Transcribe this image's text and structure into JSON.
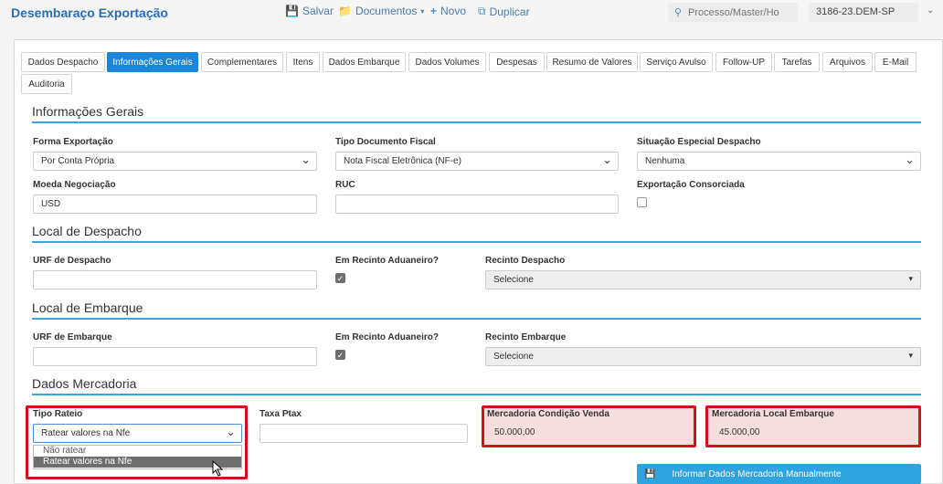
{
  "topbar": {
    "title": "Desembaraço Exportação",
    "save": "Salvar",
    "documents": "Documentos",
    "new": "Novo",
    "duplicate": "Duplicar",
    "search_placeholder": "Processo/Master/Ho",
    "process": "3186-23.DEM-SP"
  },
  "tabs": [
    "Dados Despacho",
    "Informações Gerais",
    "Complementares",
    "Itens",
    "Dados Embarque",
    "Dados Volumes",
    "Despesas",
    "Resumo de Valores",
    "Serviço Avulso",
    "Follow-UP",
    "Tarefas",
    "Arquivos",
    "E-Mail",
    "Auditoria"
  ],
  "active_tab": "Informações Gerais",
  "info_gerais": {
    "title": "Informações Gerais",
    "forma_label": "Forma Exportação",
    "forma_value": "Por Conta Própria",
    "tipo_doc_label": "Tipo Documento Fiscal",
    "tipo_doc_value": "Nota Fiscal Eletrônica (NF-e)",
    "situacao_label": "Situação Especial Despacho",
    "situacao_value": "Nenhuma",
    "moeda_label": "Moeda Negociação",
    "moeda_value": "USD",
    "ruc_label": "RUC",
    "ruc_value": "",
    "consorciada_label": "Exportação Consorciada"
  },
  "despacho": {
    "title": "Local de Despacho",
    "urf_label": "URF de Despacho",
    "urf_value": "",
    "recinto_q_label": "Em Recinto Aduaneiro?",
    "recinto_label": "Recinto Despacho",
    "recinto_value": "Selecione"
  },
  "embarque": {
    "title": "Local de Embarque",
    "urf_label": "URF de Embarque",
    "urf_value": "",
    "recinto_q_label": "Em Recinto Aduaneiro?",
    "recinto_label": "Recinto Embarque",
    "recinto_value": "Selecione"
  },
  "mercadoria": {
    "title": "Dados Mercadoria",
    "tipo_rateio_label": "Tipo Rateio",
    "tipo_rateio_value": "Ratear valores na Nfe",
    "tipo_rateio_options": [
      "Não ratear",
      "Ratear valores na Nfe"
    ],
    "taxa_label": "Taxa Ptax",
    "taxa_value": "",
    "cond_venda_label": "Mercadoria Condição Venda",
    "cond_venda_value": "50.000,00",
    "local_emb_label": "Mercadoria Local Embarque",
    "local_emb_value": "45.000,00",
    "manual_button": "Informar Dados Mercadoria Manualmente"
  },
  "colors": {
    "accent": "#1b85d8",
    "title": "#2a6db5",
    "section_line": "#35a9dd",
    "highlight": "#d3101b",
    "button": "#2ea3dd"
  }
}
